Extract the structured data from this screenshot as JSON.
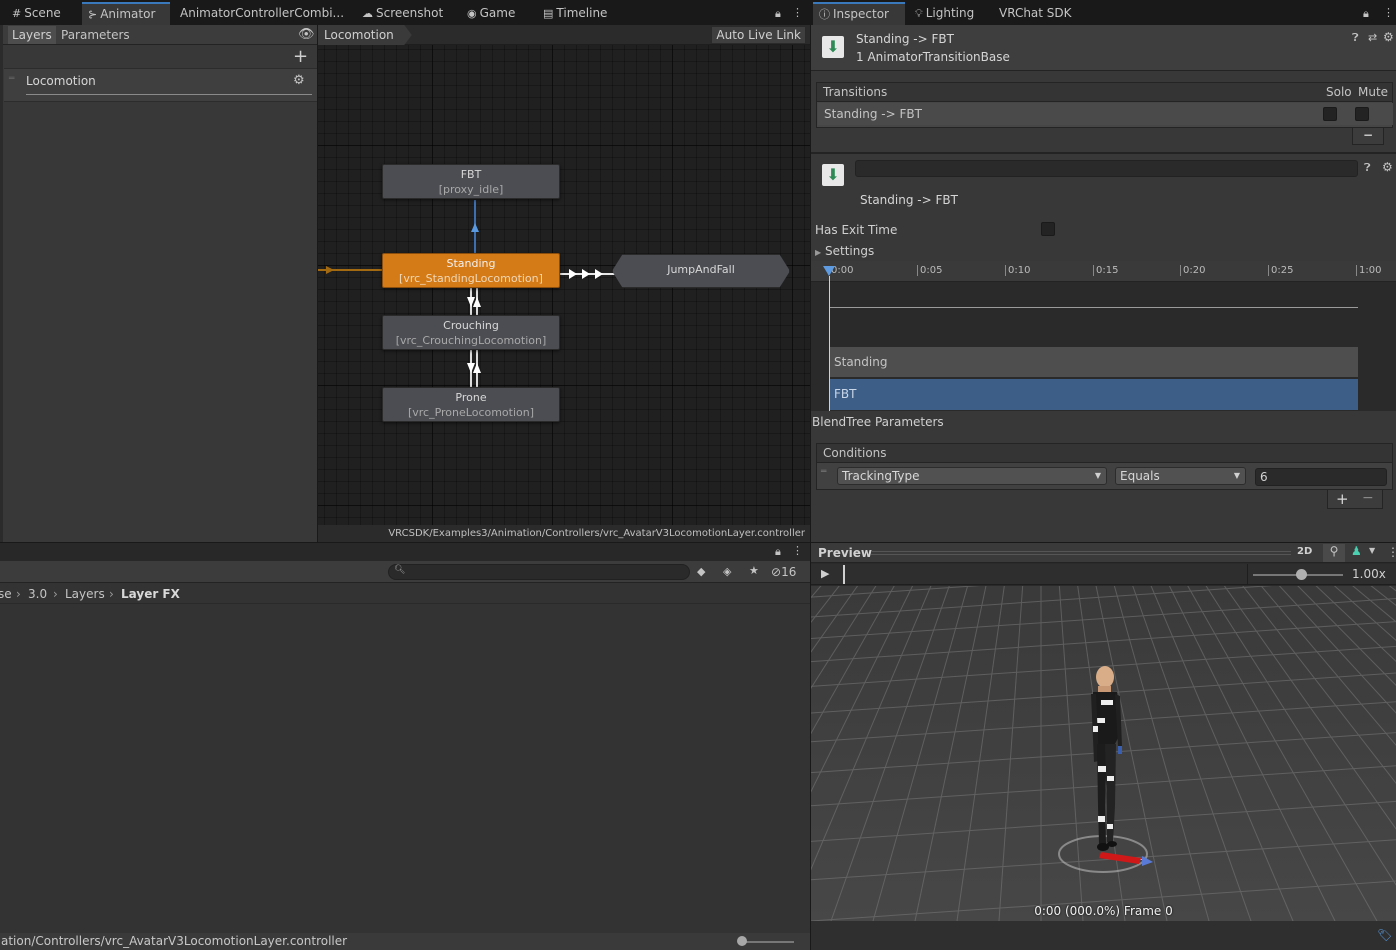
{
  "left_tabs": {
    "scene": "Scene",
    "animator": "Animator",
    "controller": "AnimatorControllerCombi...",
    "screenshot": "Screenshot",
    "game": "Game",
    "timeline": "Timeline"
  },
  "right_tabs": {
    "inspector": "Inspector",
    "lighting": "Lighting",
    "vrchat": "VRChat SDK"
  },
  "animator": {
    "tab_layers": "Layers",
    "tab_parameters": "Parameters",
    "breadcrumb": "Locomotion",
    "auto_live_link": "Auto Live Link",
    "layer_name": "Locomotion",
    "path": "VRCSDK/Examples3/Animation/Controllers/vrc_AvatarV3LocomotionLayer.controller",
    "nodes": [
      {
        "title": "FBT",
        "sub": "[proxy_idle]"
      },
      {
        "title": "Standing",
        "sub": "[vrc_StandingLocomotion]"
      },
      {
        "title": "Crouching",
        "sub": "[vrc_CrouchingLocomotion]"
      },
      {
        "title": "Prone",
        "sub": "[vrc_ProneLocomotion]"
      },
      {
        "title": "JumpAndFall",
        "sub": ""
      }
    ]
  },
  "project": {
    "breadcrumb": [
      "se",
      "3.0",
      "Layers",
      "Layer FX"
    ],
    "hidden_count": "16",
    "footer_path": "ation/Controllers/vrc_AvatarV3LocomotionLayer.controller"
  },
  "inspector": {
    "title": "Standing -> FBT",
    "subtitle": "1 AnimatorTransitionBase",
    "transitions_header": "Transitions",
    "solo": "Solo",
    "mute": "Mute",
    "transition_row": "Standing -> FBT",
    "transition_name": "Standing -> FBT",
    "has_exit_time": "Has Exit Time",
    "settings": "Settings",
    "timeline_ticks": [
      "0:00",
      "0:05",
      "0:10",
      "0:15",
      "0:20",
      "0:25",
      "1:00"
    ],
    "track_from": "Standing",
    "track_to": "FBT",
    "blendtree_params": "BlendTree Parameters",
    "conditions_header": "Conditions",
    "condition": {
      "parameter": "TrackingType",
      "mode": "Equals",
      "value": "6"
    }
  },
  "preview": {
    "title": "Preview",
    "mode_2d": "2D",
    "speed": "1.00x",
    "status": "0:00 (000.0%) Frame 0"
  },
  "colors": {
    "accent_blue": "#3a79bb",
    "state_orange": "#d47b17",
    "fbt_track": "#3d5e86"
  }
}
